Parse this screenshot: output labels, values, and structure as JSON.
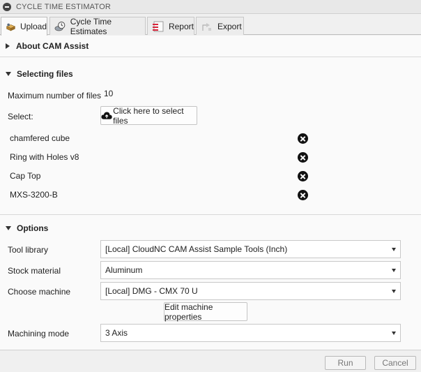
{
  "panel": {
    "title": "CYCLE TIME ESTIMATOR"
  },
  "tabs": [
    {
      "label": "Upload",
      "icon": "upload-box-icon",
      "active": true
    },
    {
      "label": "Cycle Time Estimates",
      "icon": "stopwatch-icon",
      "active": false
    },
    {
      "label": "Report",
      "icon": "report-icon",
      "active": false
    },
    {
      "label": "Export",
      "icon": "export-icon",
      "active": false
    }
  ],
  "about": {
    "title": "About CAM Assist",
    "expanded": false
  },
  "selecting": {
    "title": "Selecting files",
    "expanded": true,
    "max_files_label": "Maximum number of files",
    "max_files_value": "10",
    "select_label": "Select:",
    "select_button": "Click here to select files",
    "files": [
      "chamfered cube",
      "Ring with Holes v8",
      "Cap Top",
      "MXS-3200-B"
    ]
  },
  "options": {
    "title": "Options",
    "expanded": true,
    "tool_library_label": "Tool library",
    "tool_library_value": "[Local] CloudNC CAM Assist Sample Tools (Inch)",
    "stock_material_label": "Stock material",
    "stock_material_value": "Aluminum",
    "machine_label": "Choose machine",
    "machine_value": "[Local] DMG - CMX 70 U",
    "edit_machine_button": "Edit machine properties",
    "machining_mode_label": "Machining mode",
    "machining_mode_value": "3 Axis"
  },
  "footer": {
    "run": "Run",
    "cancel": "Cancel"
  }
}
